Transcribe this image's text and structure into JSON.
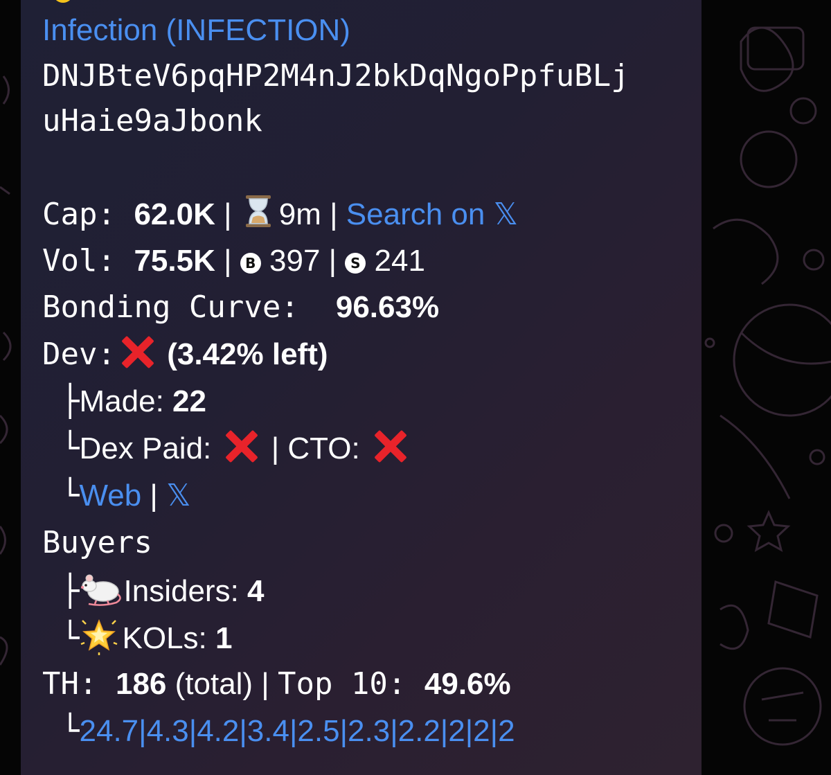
{
  "token": {
    "name_link": "Infection (INFECTION)",
    "address_line1": "DNJBteV6pqHP2M4nJ2bkDqNgoPpfuBLj",
    "address_line2": "uHaie9aJbonk"
  },
  "stats": {
    "cap_label": "Cap: ",
    "cap_value": "62.0K",
    "sep": " | ",
    "age_value": "9m",
    "search_link": "Search on ",
    "x_glyph": "𝕏",
    "vol_label": "Vol: ",
    "vol_value": "75.5K",
    "buys_badge": "B",
    "buys_value": "397",
    "sells_badge": "S",
    "sells_value": "241",
    "bonding_label": "Bonding Curve:  ",
    "bonding_value": "96.63%"
  },
  "dev": {
    "label": "Dev:",
    "left_value": "(3.42% left)",
    "made_prefix": "├",
    "made_label": "Made: ",
    "made_value": "22",
    "dex_prefix": "└",
    "dex_label": "Dex Paid: ",
    "cto_label": " | CTO: ",
    "links_prefix": "└",
    "web_link": "Web",
    "links_sep": " | "
  },
  "buyers": {
    "label": "Buyers",
    "insiders_prefix": "├",
    "insiders_label": "Insiders: ",
    "insiders_value": "4",
    "kols_prefix": "└",
    "kols_label": "KOLs: ",
    "kols_value": "1"
  },
  "holders": {
    "label": "TH: ",
    "total_value": "186",
    "total_suffix": " (total) | ",
    "top_label": "Top 10: ",
    "top_value": "49.6%",
    "list_prefix": "└",
    "top_list": [
      "24.7",
      "4.3",
      "4.2",
      "3.4",
      "2.5",
      "2.3",
      "2.2",
      "2",
      "2",
      "2"
    ]
  },
  "colors": {
    "link": "#4a8ff0",
    "cross": "#e8232a",
    "bubble": "#221f33"
  }
}
